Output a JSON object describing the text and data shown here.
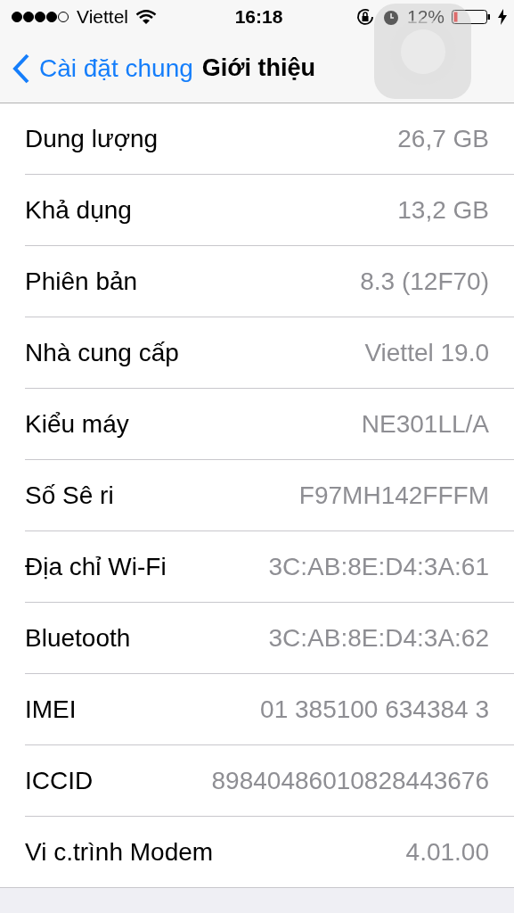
{
  "status_bar": {
    "carrier": "Viettel",
    "time": "16:18",
    "battery": "12%"
  },
  "nav": {
    "back": "Cài đặt chung",
    "title": "Giới thiệu"
  },
  "rows": [
    {
      "label": "Dung lượng",
      "value": "26,7 GB"
    },
    {
      "label": "Khả dụng",
      "value": "13,2 GB"
    },
    {
      "label": "Phiên bản",
      "value": "8.3 (12F70)"
    },
    {
      "label": "Nhà cung cấp",
      "value": "Viettel 19.0"
    },
    {
      "label": "Kiểu máy",
      "value": "NE301LL/A"
    },
    {
      "label": "Số Sê ri",
      "value": "F97MH142FFFM"
    },
    {
      "label": "Địa chỉ Wi-Fi",
      "value": "3C:AB:8E:D4:3A:61"
    },
    {
      "label": "Bluetooth",
      "value": "3C:AB:8E:D4:3A:62"
    },
    {
      "label": "IMEI",
      "value": "01 385100 634384 3"
    },
    {
      "label": "ICCID",
      "value": "89840486010828443676"
    },
    {
      "label": "Vi c.trình Modem",
      "value": "4.01.00"
    }
  ]
}
